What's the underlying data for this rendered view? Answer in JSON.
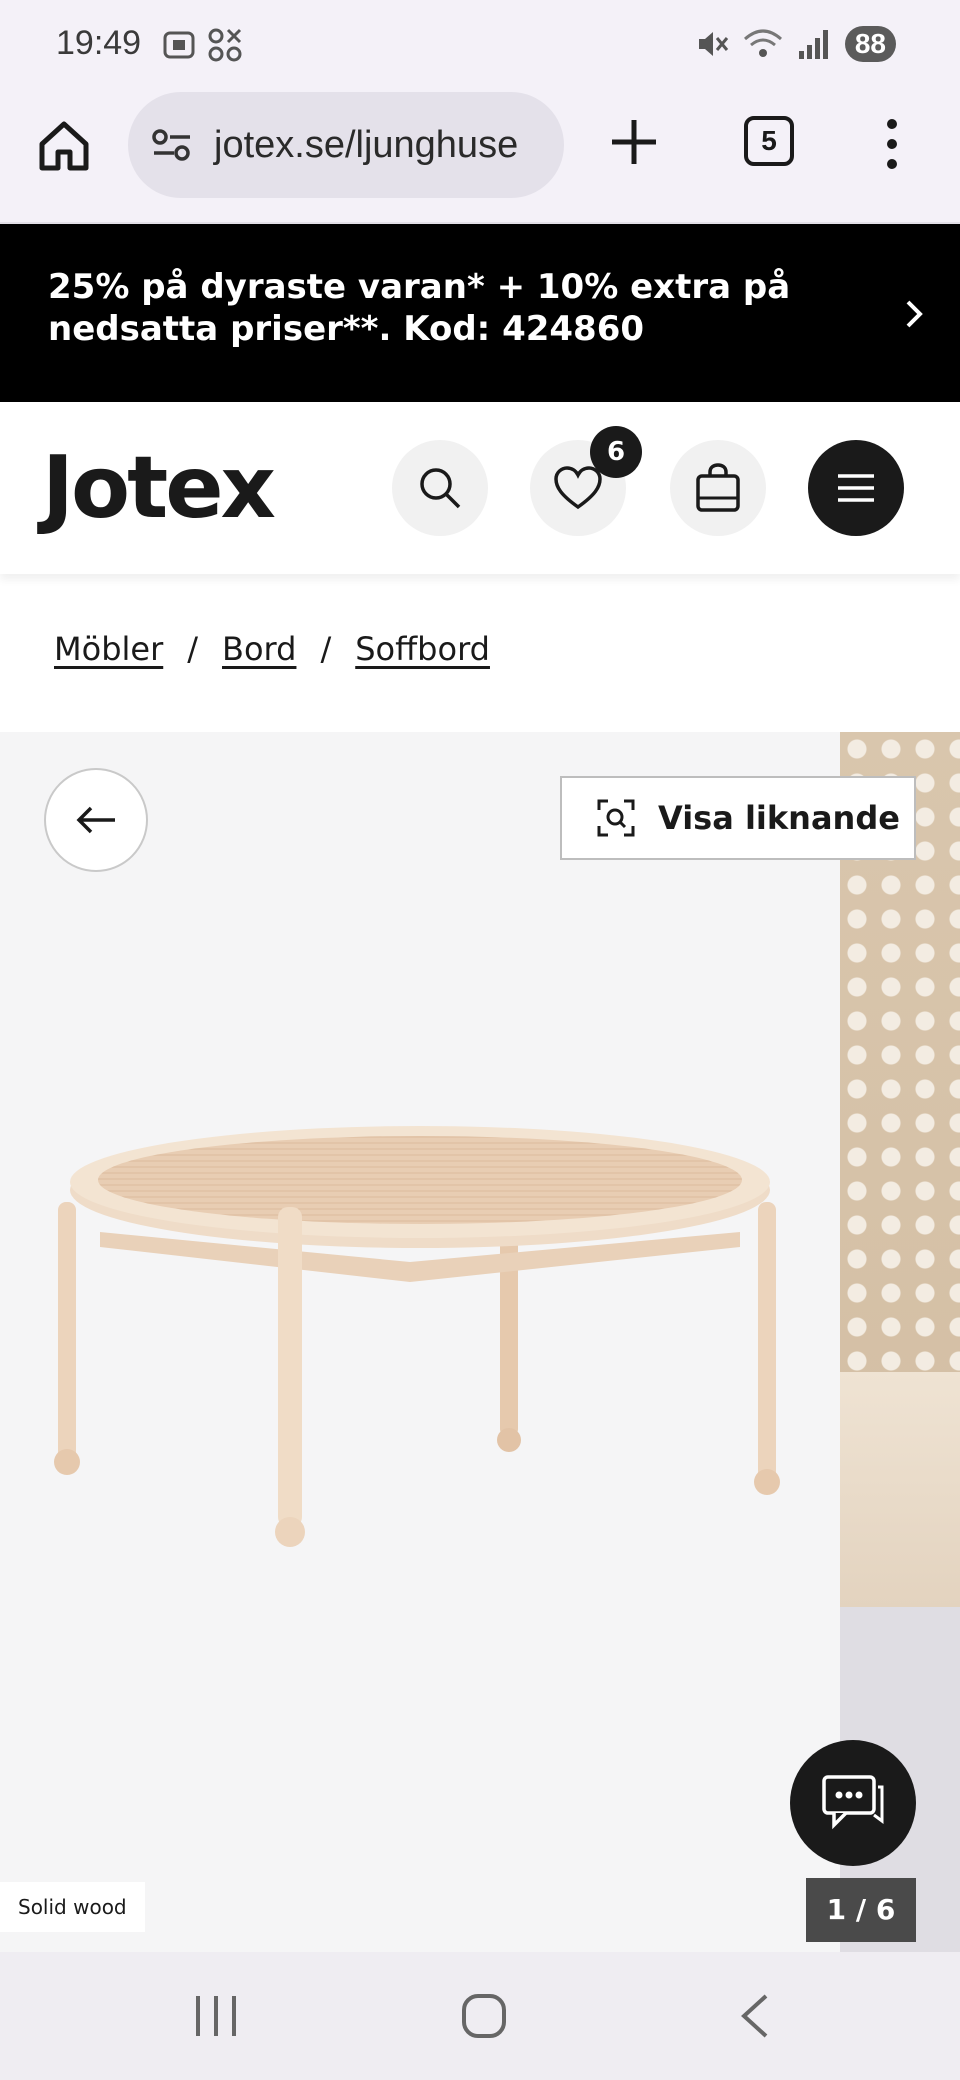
{
  "status_bar": {
    "time": "19:49",
    "battery": "88"
  },
  "browser": {
    "url": "jotex.se/ljunghuse",
    "tab_count": "5"
  },
  "promo": {
    "text": "25% på dyraste varan* + 10% extra på nedsatta priser**. Kod: 424860"
  },
  "header": {
    "logo": "Jotex",
    "wishlist_count": "6"
  },
  "breadcrumb": {
    "items": [
      "Möbler",
      "Bord",
      "Soffbord"
    ],
    "separator": "/"
  },
  "gallery": {
    "similar_label": "Visa liknande",
    "material_tag": "Solid wood",
    "counter": "1 / 6"
  },
  "colors": {
    "banner_bg": "#000000",
    "accent_dark": "#1a1a1a",
    "gallery_bg": "#f5f5f6"
  }
}
